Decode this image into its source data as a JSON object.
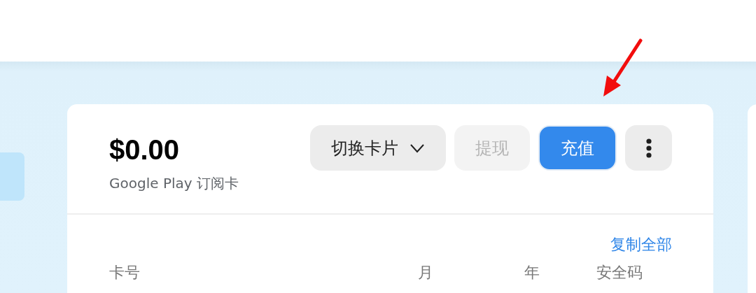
{
  "balance": {
    "amount": "$0.00",
    "card_name": "Google Play 订阅卡"
  },
  "buttons": [
    {
      "label": "切换卡片",
      "kind": "dropdown",
      "disabled": false
    },
    {
      "label": "提现",
      "kind": "secondary",
      "disabled": true
    },
    {
      "label": "充值",
      "kind": "primary",
      "disabled": false
    },
    {
      "kind": "more",
      "disabled": false
    }
  ],
  "copy_all_link": "复制全部",
  "columns": [
    "卡号",
    "月",
    "年",
    "安全码"
  ]
}
